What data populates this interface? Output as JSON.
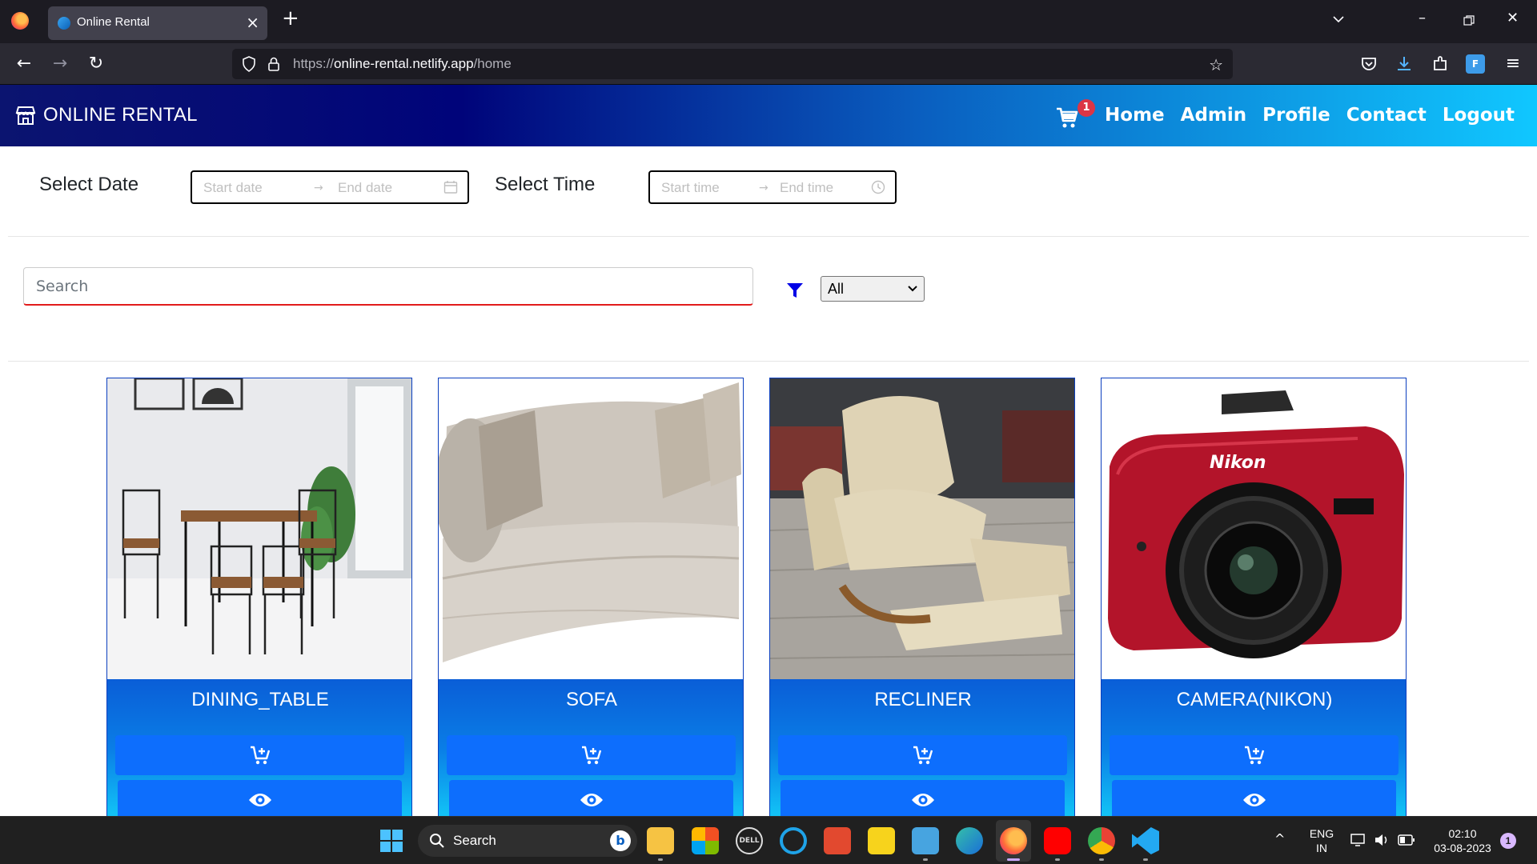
{
  "browser": {
    "tab_title": "Online Rental",
    "url_base": "https://",
    "url_host": "online-rental.netlify.app",
    "url_path": "/home"
  },
  "header": {
    "brand": "ONLINE RENTAL",
    "cart_count": "1",
    "links": {
      "home": "Home",
      "admin": "Admin",
      "profile": "Profile",
      "contact": "Contact",
      "logout": "Logout"
    }
  },
  "filters": {
    "date_label": "Select Date",
    "start_date_placeholder": "Start date",
    "end_date_placeholder": "End date",
    "time_label": "Select Time",
    "start_time_placeholder": "Start time",
    "end_time_placeholder": "End time",
    "search_placeholder": "Search",
    "category_selected": "All"
  },
  "products": [
    {
      "name": "DINING_TABLE"
    },
    {
      "name": "SOFA"
    },
    {
      "name": "RECLINER"
    },
    {
      "name": "CAMERA(NIKON)"
    }
  ],
  "taskbar": {
    "search_label": "Search",
    "lang_line1": "ENG",
    "lang_line2": "IN",
    "time": "02:10",
    "date": "03-08-2023",
    "notification_count": "1"
  },
  "colors": {
    "header_gradient_start": "#00047a",
    "header_gradient_end": "#10c7ff",
    "button_primary": "#0d6efd",
    "cart_badge": "#dc3545",
    "search_underline": "#e21b1b"
  }
}
